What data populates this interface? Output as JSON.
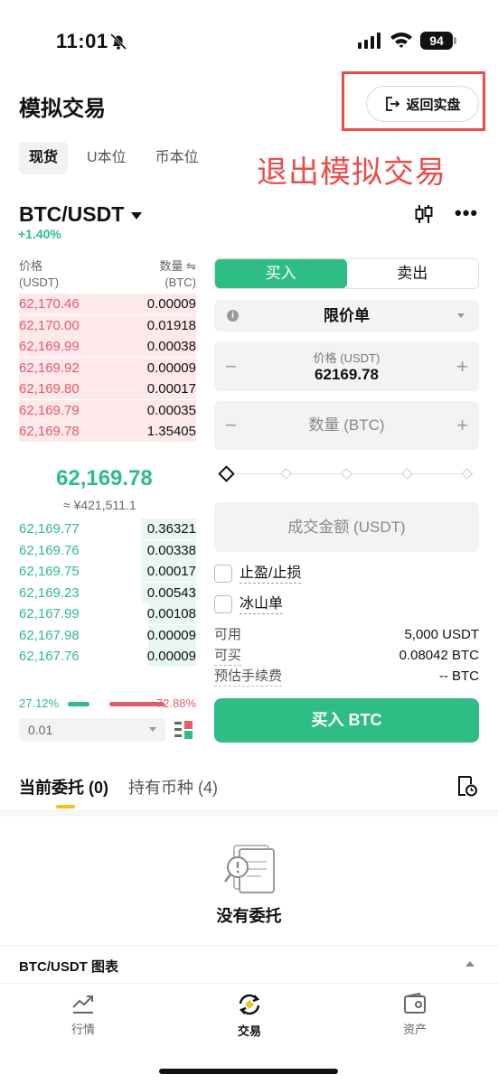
{
  "status": {
    "time": "11:01",
    "battery": "94"
  },
  "header": {
    "title": "模拟交易",
    "back_button": "返回实盘",
    "annotation": "退出模拟交易"
  },
  "market_tabs": [
    "现货",
    "U本位",
    "币本位"
  ],
  "pair": {
    "symbol": "BTC/USDT",
    "change": "+1.40%"
  },
  "orderbook": {
    "header_left": [
      "价格",
      "(USDT)"
    ],
    "header_right": [
      "数量 ⇋",
      "(BTC)"
    ],
    "asks": [
      {
        "price": "62,170.46",
        "qty": "0.00009",
        "depth": 1.0
      },
      {
        "price": "62,170.00",
        "qty": "0.01918",
        "depth": 1.0
      },
      {
        "price": "62,169.99",
        "qty": "0.00038",
        "depth": 1.0
      },
      {
        "price": "62,169.92",
        "qty": "0.00009",
        "depth": 1.0
      },
      {
        "price": "62,169.80",
        "qty": "0.00017",
        "depth": 1.0
      },
      {
        "price": "62,169.79",
        "qty": "0.00035",
        "depth": 1.0
      },
      {
        "price": "62,169.78",
        "qty": "1.35405",
        "depth": 1.0
      }
    ],
    "mid_price": "62,169.78",
    "mid_fiat": "≈ ¥421,511.1",
    "bids": [
      {
        "price": "62,169.77",
        "qty": "0.36321",
        "depth": 0.31
      },
      {
        "price": "62,169.76",
        "qty": "0.00338",
        "depth": 0.31
      },
      {
        "price": "62,169.75",
        "qty": "0.00017",
        "depth": 0.31
      },
      {
        "price": "62,169.23",
        "qty": "0.00543",
        "depth": 0.31
      },
      {
        "price": "62,167.99",
        "qty": "0.00108",
        "depth": 0.27
      },
      {
        "price": "62,167.98",
        "qty": "0.00009",
        "depth": 0.27
      },
      {
        "price": "62,167.76",
        "qty": "0.00009",
        "depth": 0.27
      }
    ],
    "buy_pct": "27.12%",
    "sell_pct": "72.88%",
    "precision": "0.01"
  },
  "form": {
    "buy_label": "买入",
    "sell_label": "卖出",
    "order_type": "限价单",
    "price_label": "价格 (USDT)",
    "price_value": "62169.78",
    "qty_placeholder": "数量 (BTC)",
    "amount_placeholder": "成交金额 (USDT)",
    "tp_sl": "止盈/止损",
    "iceberg": "冰山单",
    "available_label": "可用",
    "available_value": "5,000 USDT",
    "max_buy_label": "可买",
    "max_buy_value": "0.08042 BTC",
    "fee_label": "预估手续费",
    "fee_value": "-- BTC",
    "submit": "买入 BTC"
  },
  "orders": {
    "tab_open": "当前委托 (0)",
    "tab_holdings": "持有币种 (4)",
    "empty": "没有委托",
    "chart_toggle": "BTC/USDT 图表"
  },
  "nav": {
    "markets": "行情",
    "trade": "交易",
    "assets": "资产"
  },
  "colors": {
    "green": "#2ebd85",
    "red": "#e85a6c",
    "annotation_red": "#ee4b4b"
  }
}
